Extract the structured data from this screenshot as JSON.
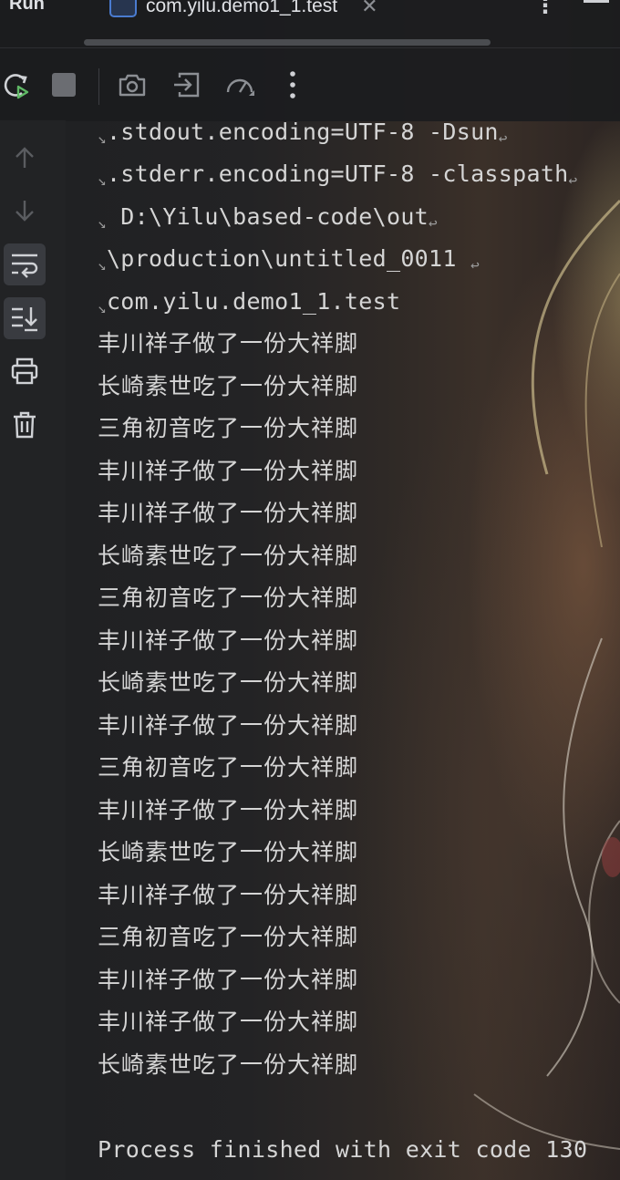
{
  "window": {
    "tool_title": "Run",
    "tab_label": "com.yilu.demo1_1.test"
  },
  "icons": {
    "tab": [
      "java-file-icon",
      "close-icon",
      "more-vert-icon",
      "minimize-icon"
    ],
    "toolbar": [
      "rerun-icon",
      "stop-icon",
      "screenshot-icon",
      "exit-icon",
      "profiler-icon",
      "more-vert-icon"
    ],
    "sidebar": [
      "arrow-up-icon",
      "arrow-down-icon",
      "soft-wrap-icon",
      "scroll-to-end-icon",
      "print-icon",
      "trash-icon"
    ]
  },
  "colors": {
    "background": "#1b1c1e",
    "console_text": "#d5d5d5",
    "accent_green": "#5fb865",
    "tab_icon_blue": "#4a7bd0"
  },
  "console": {
    "command_lines": [
      ".stdout.encoding=UTF-8 -Dsun",
      ".stderr.encoding=UTF-8 -classpath",
      " D:\\Yilu\\based-code\\out",
      "\\production\\untitled_0011 ",
      "com.yilu.demo1_1.test"
    ],
    "output_lines": [
      "丰川祥子做了一份大祥脚",
      "长崎素世吃了一份大祥脚",
      "三角初音吃了一份大祥脚",
      "丰川祥子做了一份大祥脚",
      "丰川祥子做了一份大祥脚",
      "长崎素世吃了一份大祥脚",
      "三角初音吃了一份大祥脚",
      "丰川祥子做了一份大祥脚",
      "长崎素世吃了一份大祥脚",
      "丰川祥子做了一份大祥脚",
      "三角初音吃了一份大祥脚",
      "丰川祥子做了一份大祥脚",
      "长崎素世吃了一份大祥脚",
      "丰川祥子做了一份大祥脚",
      "三角初音吃了一份大祥脚",
      "丰川祥子做了一份大祥脚",
      "丰川祥子做了一份大祥脚",
      "长崎素世吃了一份大祥脚"
    ],
    "exit_message": "Process finished with exit code 130"
  }
}
